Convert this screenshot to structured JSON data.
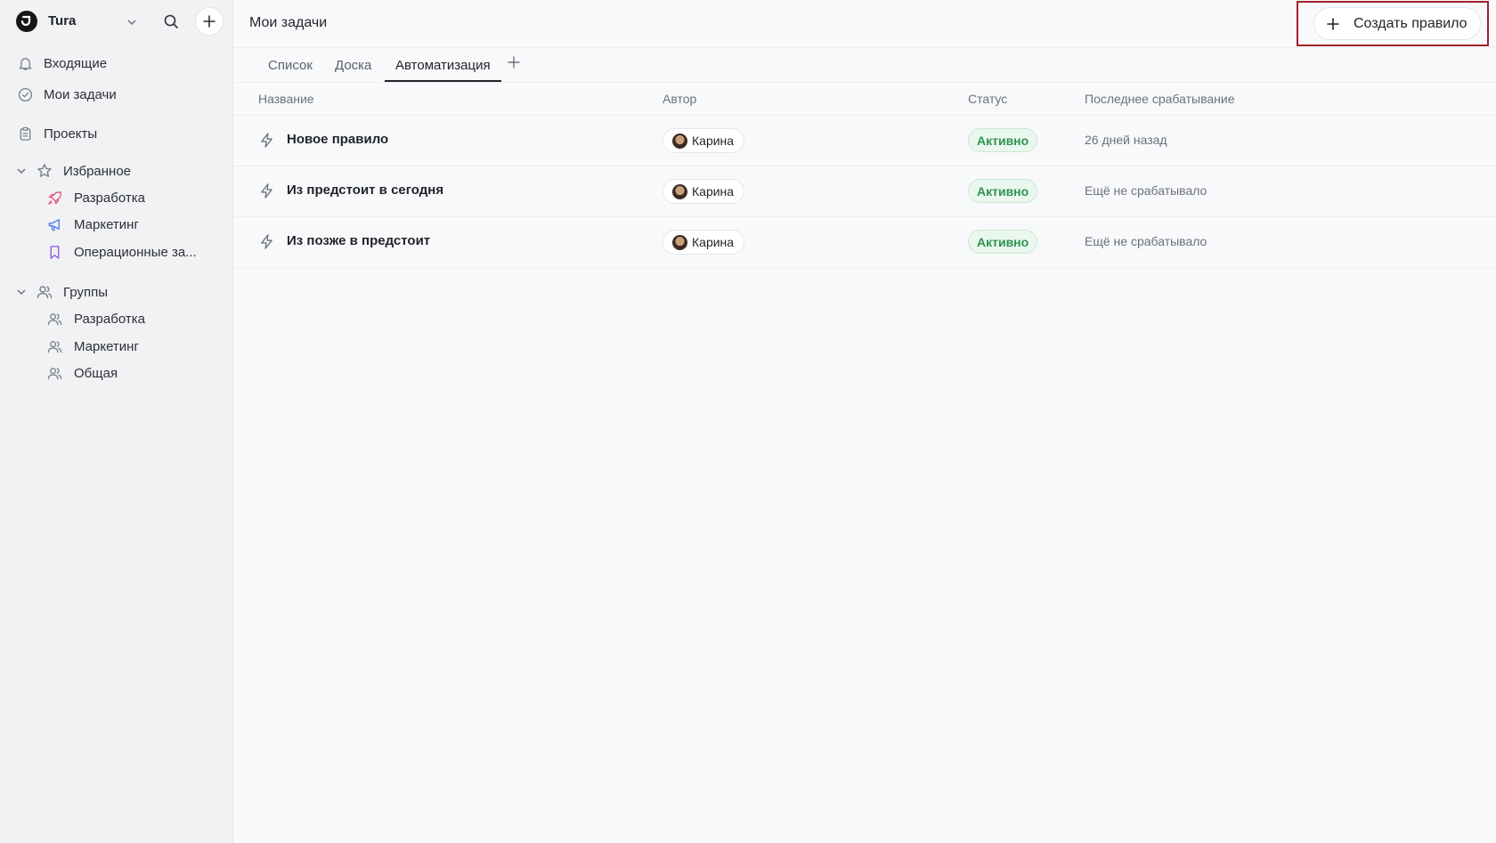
{
  "workspace": {
    "name": "Tura"
  },
  "sidebar": {
    "nav": [
      {
        "label": "Входящие",
        "icon": "bell-icon"
      },
      {
        "label": "Мои задачи",
        "icon": "check-circle-icon"
      },
      {
        "label": "Проекты",
        "icon": "clipboard-icon"
      }
    ],
    "favorites": {
      "label": "Избранное",
      "items": [
        {
          "label": "Разработка",
          "icon": "rocket-icon",
          "color": "#e0537a"
        },
        {
          "label": "Маркетинг",
          "icon": "megaphone-icon",
          "color": "#4f7be8"
        },
        {
          "label": "Операционные за...",
          "icon": "bookmark-icon",
          "color": "#8a55e6"
        }
      ]
    },
    "groups": {
      "label": "Группы",
      "items": [
        {
          "label": "Разработка",
          "icon": "users-icon"
        },
        {
          "label": "Маркетинг",
          "icon": "users-icon"
        },
        {
          "label": "Общая",
          "icon": "users-icon"
        }
      ]
    }
  },
  "header": {
    "title": "Мои задачи",
    "create_button": "Создать правило"
  },
  "tabs": [
    {
      "label": "Список",
      "active": false
    },
    {
      "label": "Доска",
      "active": false
    },
    {
      "label": "Автоматизация",
      "active": true
    }
  ],
  "table": {
    "columns": [
      "Название",
      "Автор",
      "Статус",
      "Последнее срабатывание"
    ],
    "rows": [
      {
        "name": "Новое правило",
        "author": "Карина",
        "status": "Активно",
        "last": "26 дней назад"
      },
      {
        "name": "Из предстоит в сегодня",
        "author": "Карина",
        "status": "Активно",
        "last": "Ещё не срабатывало"
      },
      {
        "name": "Из позже в предстоит",
        "author": "Карина",
        "status": "Активно",
        "last": "Ещё не срабатывало"
      }
    ]
  },
  "colors": {
    "accent_dark": "#1f2328",
    "status_active": "#2f9350",
    "highlight": "#a3202a"
  }
}
